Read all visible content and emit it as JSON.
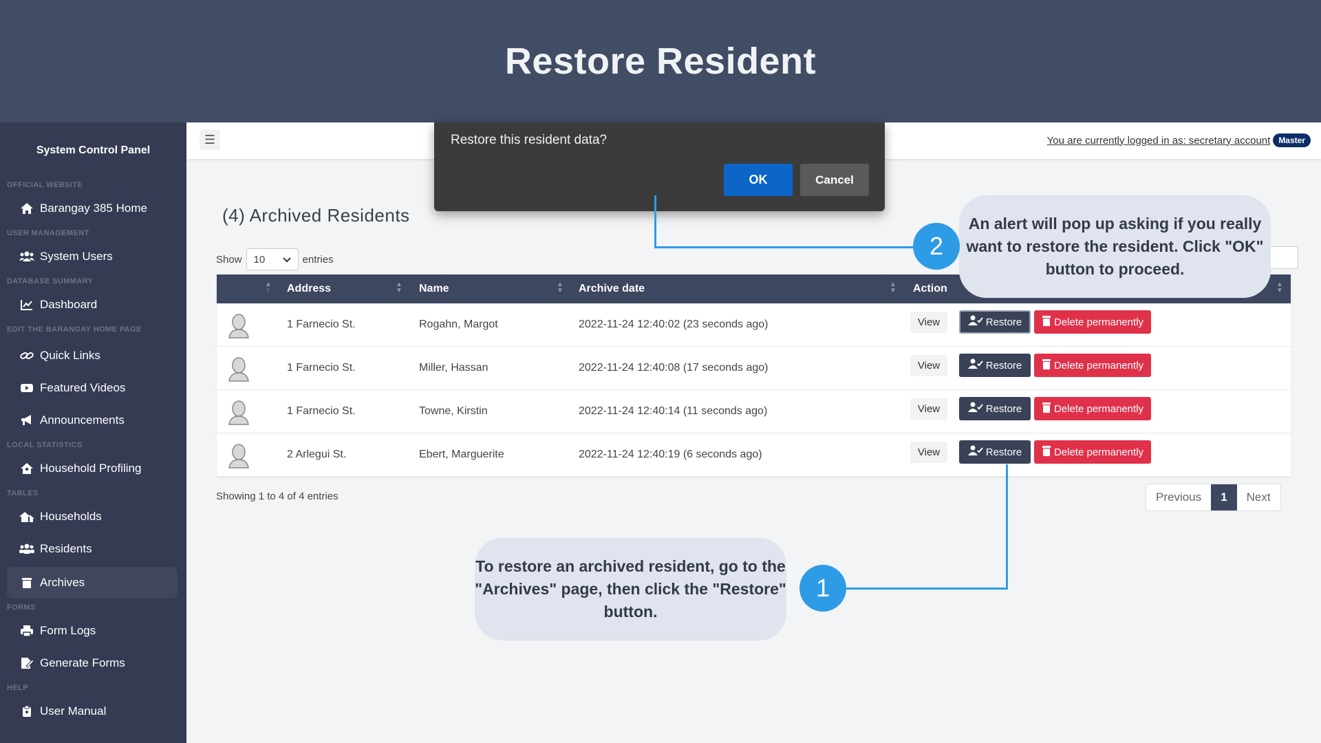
{
  "banner": {
    "title": "Restore Resident"
  },
  "sidebar": {
    "title": "System Control Panel",
    "sections": {
      "official_website": "OFFICIAL WEBSITE",
      "user_management": "USER MANAGEMENT",
      "database_summary": "DATABASE SUMMARY",
      "edit_home": "EDIT THE BARANGAY HOME PAGE",
      "local_statistics": "LOCAL STATISTICS",
      "tables": "TABLES",
      "forms": "FORMS",
      "help": "HELP"
    },
    "items": {
      "home": "Barangay 385 Home",
      "system_users": "System Users",
      "dashboard": "Dashboard",
      "quick_links": "Quick Links",
      "featured_videos": "Featured Videos",
      "announcements": "Announcements",
      "household_profiling": "Household Profiling",
      "households": "Households",
      "residents": "Residents",
      "archives": "Archives",
      "form_logs": "Form Logs",
      "generate_forms": "Generate Forms",
      "user_manual": "User Manual"
    }
  },
  "topbar": {
    "logged_in": "You are currently logged in as: secretary account",
    "role_badge": "Master"
  },
  "page": {
    "title": "(4) Archived Residents",
    "show_label": "Show",
    "entries_value": "10",
    "entries_label": "entries",
    "showing": "Showing 1 to 4 of 4 entries"
  },
  "table": {
    "columns": {
      "address": "Address",
      "name": "Name",
      "archive_date": "Archive date",
      "action": "Action"
    },
    "rows": [
      {
        "address": "1 Farnecio St.",
        "name": "Rogahn, Margot",
        "date": "2022-11-24 12:40:02 (23 seconds ago)"
      },
      {
        "address": "1 Farnecio St.",
        "name": "Miller, Hassan",
        "date": "2022-11-24 12:40:08 (17 seconds ago)"
      },
      {
        "address": "1 Farnecio St.",
        "name": "Towne, Kirstin",
        "date": "2022-11-24 12:40:14 (11 seconds ago)"
      },
      {
        "address": "2 Arlegui St.",
        "name": "Ebert, Marguerite",
        "date": "2022-11-24 12:40:19 (6 seconds ago)"
      }
    ],
    "view_label": "View",
    "restore_label": "Restore",
    "delete_label": "Delete permanently"
  },
  "pager": {
    "previous": "Previous",
    "current": "1",
    "next": "Next"
  },
  "dialog": {
    "message": "Restore this resident data?",
    "ok": "OK",
    "cancel": "Cancel"
  },
  "callouts": {
    "step1_number": "1",
    "step1_text": "To restore an archived resident, go to the \"Archives\" page, then click the \"Restore\" button.",
    "step2_number": "2",
    "step2_text": "An alert will pop up asking if you really want to restore the resident. Click \"OK\" button to proceed."
  },
  "colors": {
    "banner": "#414c65",
    "sidebar": "#343b52",
    "table_header": "#3e4760",
    "ok_button": "#0b66c8",
    "delete_button": "#e0314b",
    "callout_accent": "#2e9be6"
  }
}
